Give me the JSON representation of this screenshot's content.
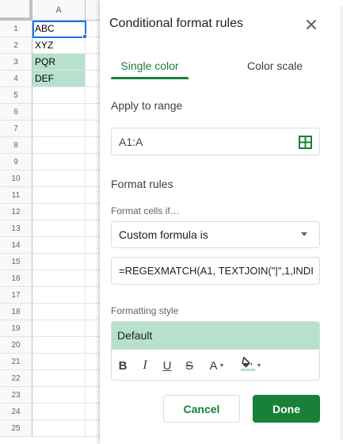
{
  "sheet": {
    "column_header": "A",
    "rows": [
      {
        "num": "1",
        "value": "ABC",
        "highlighted": false
      },
      {
        "num": "2",
        "value": "XYZ",
        "highlighted": false
      },
      {
        "num": "3",
        "value": "PQR",
        "highlighted": true
      },
      {
        "num": "4",
        "value": "DEF",
        "highlighted": true
      },
      {
        "num": "5",
        "value": "",
        "highlighted": false
      },
      {
        "num": "6",
        "value": "",
        "highlighted": false
      },
      {
        "num": "7",
        "value": "",
        "highlighted": false
      },
      {
        "num": "8",
        "value": "",
        "highlighted": false
      },
      {
        "num": "9",
        "value": "",
        "highlighted": false
      },
      {
        "num": "10",
        "value": "",
        "highlighted": false
      },
      {
        "num": "11",
        "value": "",
        "highlighted": false
      },
      {
        "num": "12",
        "value": "",
        "highlighted": false
      },
      {
        "num": "13",
        "value": "",
        "highlighted": false
      },
      {
        "num": "14",
        "value": "",
        "highlighted": false
      },
      {
        "num": "15",
        "value": "",
        "highlighted": false
      },
      {
        "num": "16",
        "value": "",
        "highlighted": false
      },
      {
        "num": "17",
        "value": "",
        "highlighted": false
      },
      {
        "num": "18",
        "value": "",
        "highlighted": false
      },
      {
        "num": "19",
        "value": "",
        "highlighted": false
      },
      {
        "num": "20",
        "value": "",
        "highlighted": false
      },
      {
        "num": "21",
        "value": "",
        "highlighted": false
      },
      {
        "num": "22",
        "value": "",
        "highlighted": false
      },
      {
        "num": "23",
        "value": "",
        "highlighted": false
      },
      {
        "num": "24",
        "value": "",
        "highlighted": false
      },
      {
        "num": "25",
        "value": "",
        "highlighted": false
      }
    ],
    "highlight_color": "#b7e1cd",
    "selection_color": "#1a73e8"
  },
  "panel": {
    "title": "Conditional format rules",
    "close_icon": "close-icon",
    "tabs": {
      "single_color": "Single color",
      "color_scale": "Color scale"
    },
    "apply_to_range": {
      "label": "Apply to range",
      "value": "A1:A",
      "icon": "grid-select-icon"
    },
    "format_rules": {
      "label": "Format rules",
      "condition_label": "Format cells if…",
      "condition_value": "Custom formula is",
      "formula_value": "=REGEXMATCH(A1, TEXTJOIN(\"|\",1,INDI"
    },
    "formatting_style": {
      "label": "Formatting style",
      "preview_text": "Default",
      "preview_color": "#b7e1cd",
      "toolbar": {
        "bold": "B",
        "italic": "I",
        "underline": "U",
        "strikethrough": "S",
        "text_color": "A",
        "fill_color_icon": "paint-bucket-icon"
      }
    },
    "buttons": {
      "cancel": "Cancel",
      "done": "Done"
    },
    "accent_color": "#188038"
  }
}
